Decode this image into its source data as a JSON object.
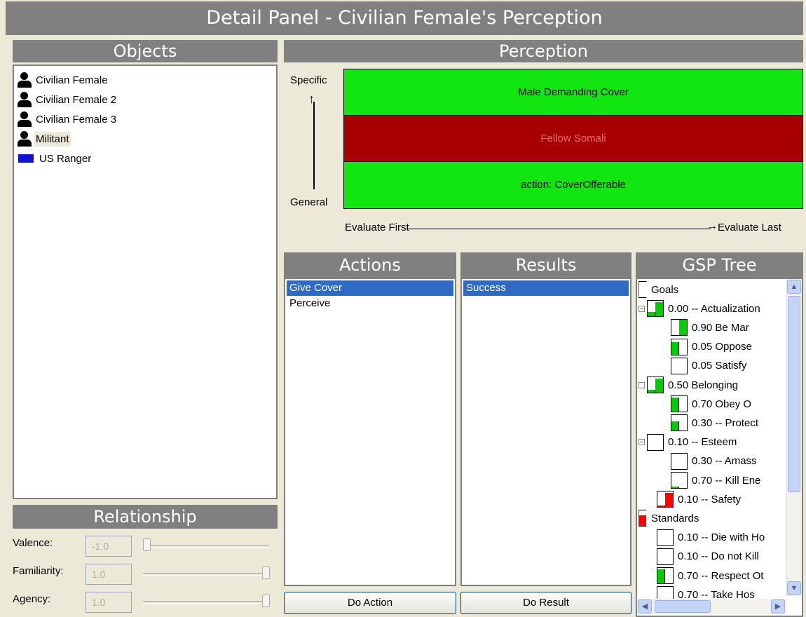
{
  "window": {
    "title": "Detail Panel - Civilian Female's Perception"
  },
  "objects": {
    "header": "Objects",
    "items": [
      {
        "label": "Civilian Female",
        "icon": "person-icon"
      },
      {
        "label": "Civilian Female 2",
        "icon": "person-icon"
      },
      {
        "label": "Civilian Female 3",
        "icon": "person-icon"
      },
      {
        "label": "Militant",
        "icon": "person-icon",
        "selected": true
      },
      {
        "label": "US Ranger",
        "icon": "flag-icon"
      }
    ]
  },
  "relationship": {
    "header": "Relationship",
    "rows": [
      {
        "label": "Valence:",
        "value": "-1.0",
        "slider": 0.0
      },
      {
        "label": "Familiarity:",
        "value": "1.0",
        "slider": 1.0
      },
      {
        "label": "Agency:",
        "value": "1.0",
        "slider": 1.0
      }
    ]
  },
  "perception": {
    "header": "Perception",
    "specific_label": "Specific",
    "general_label": "General",
    "eval_first": "Evaluate First",
    "eval_last": "Evaluate Last",
    "bands": [
      {
        "label": "Male Demanding Cover",
        "color": "#11e611"
      },
      {
        "label": "Fellow Somali",
        "color": "#a80000"
      },
      {
        "label": "action: CoverOfferable",
        "color": "#11e611"
      }
    ]
  },
  "actions": {
    "header": "Actions",
    "items": [
      "Give Cover",
      "Perceive"
    ],
    "selected_index": 0,
    "button": "Do Action"
  },
  "results": {
    "header": "Results",
    "items": [
      "Success"
    ],
    "selected_index": 0,
    "button": "Do Result"
  },
  "gsp": {
    "header": "GSP Tree",
    "nodes": [
      {
        "label": "Goals",
        "depth": 0,
        "gauge": "bracket-red"
      },
      {
        "label": "0.00 -- Actualization",
        "depth": 1,
        "expander": "-",
        "left": 0.3,
        "right": 0.9,
        "fill": "#00cc00"
      },
      {
        "label": "0.90   Be Mar",
        "depth": 2,
        "left": 0.0,
        "right": 1.0,
        "fill": "#00cc00"
      },
      {
        "label": "0.05   Oppose",
        "depth": 2,
        "left": 0.8,
        "right": 0.0,
        "fill": "#00cc00"
      },
      {
        "label": "0.05   Satisfy",
        "depth": 2,
        "left": 0.0,
        "right": 0.0,
        "fill": "#00cc00"
      },
      {
        "label": "0.50   Belonging",
        "depth": 1,
        "expander": "+",
        "left": 0.2,
        "right": 0.9,
        "fill": "#00cc00"
      },
      {
        "label": "0.70   Obey O",
        "depth": 2,
        "left": 0.9,
        "right": 0.0,
        "fill": "#00cc00"
      },
      {
        "label": "0.30 -- Protect",
        "depth": 2,
        "left": 0.6,
        "right": 0.0,
        "fill": "#00cc00"
      },
      {
        "label": "0.10 -- Esteem",
        "depth": 1,
        "expander": "-",
        "left": 0.0,
        "right": 0.0,
        "fill": "#00cc00"
      },
      {
        "label": "0.30 -- Amass",
        "depth": 2,
        "left": 0.0,
        "right": 0.0,
        "fill": "#00cc00"
      },
      {
        "label": "0.70 -- Kill Ene",
        "depth": 2,
        "left": 0.1,
        "right": 0.0,
        "fill": "#00cc00"
      },
      {
        "label": "0.10 -- Safety",
        "depth": 1,
        "left": 0.1,
        "right": 0.9,
        "fill": "#ff0000"
      },
      {
        "label": "Standards",
        "depth": 0,
        "gauge": "bracket-red-fill"
      },
      {
        "label": "0.10 -- Die with Ho",
        "depth": 1,
        "left": 0.0,
        "right": 0.0,
        "fill": "#ff0000"
      },
      {
        "label": "0.10 -- Do not Kill",
        "depth": 1,
        "left": 0.0,
        "right": 0.0,
        "fill": "#ff0000"
      },
      {
        "label": "0.70 -- Respect Ot",
        "depth": 1,
        "left": 0.9,
        "right": 0.0,
        "fill": "#ff0000",
        "left_fill": "#00cc00",
        "right_fill2": "#ff0000"
      },
      {
        "label": "0.70 -- Take Hos",
        "depth": 1,
        "left": 0.0,
        "right": 0.0,
        "fill": "#ff0000"
      }
    ]
  }
}
